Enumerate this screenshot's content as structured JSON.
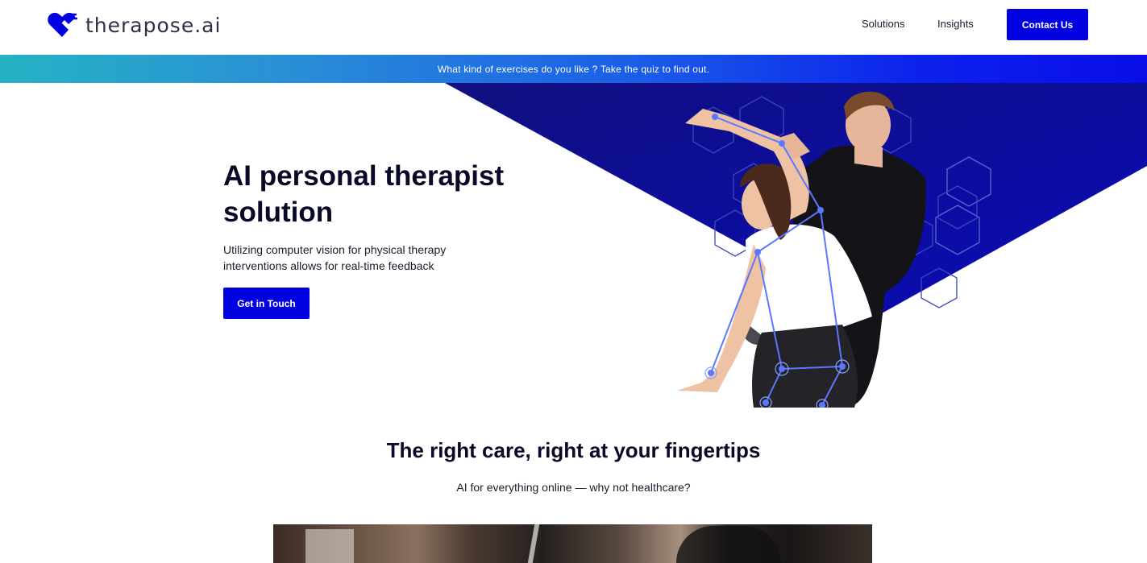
{
  "brand": {
    "name": "therapose.ai",
    "logo_icon": "heart-check-icon",
    "accent_color": "#0000e0"
  },
  "nav": {
    "items": [
      {
        "label": "Solutions"
      },
      {
        "label": "Insights"
      }
    ],
    "cta_label": "Contact Us"
  },
  "banner": {
    "text": "What kind of exercises do you like ? Take the quiz to find out."
  },
  "hero": {
    "title": "AI personal therapist solution",
    "subtitle": "Utilizing computer vision for physical therapy interventions allows for real-time feedback",
    "cta_label": "Get in Touch"
  },
  "section": {
    "title": "The right care, right at your fingertips",
    "subtitle": "AI for everything online — why not healthcare?"
  }
}
